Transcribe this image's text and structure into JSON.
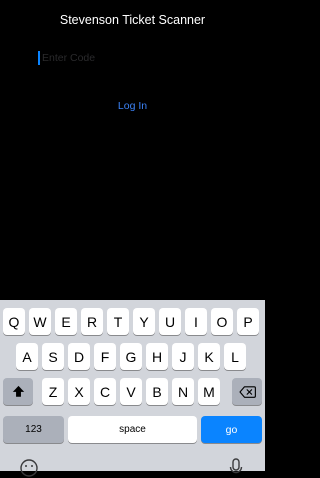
{
  "app": {
    "title": "Stevenson Ticket Scanner"
  },
  "form": {
    "placeholder": "Enter Code",
    "login_label": "Log In"
  },
  "keyboard": {
    "row1": [
      "Q",
      "W",
      "E",
      "R",
      "T",
      "Y",
      "U",
      "I",
      "O",
      "P"
    ],
    "row2": [
      "A",
      "S",
      "D",
      "F",
      "G",
      "H",
      "J",
      "K",
      "L"
    ],
    "row3": [
      "Z",
      "X",
      "C",
      "V",
      "B",
      "N",
      "M"
    ],
    "numbers_label": "123",
    "space_label": "space",
    "go_label": "go",
    "icons": {
      "shift": "shift-arrow-icon",
      "backspace": "backspace-icon",
      "emoji": "emoji-icon",
      "dictation": "microphone-icon"
    }
  },
  "colors": {
    "background": "#000000",
    "accent": "#0a84ff",
    "keyboard_bg": "#d2d5db"
  }
}
